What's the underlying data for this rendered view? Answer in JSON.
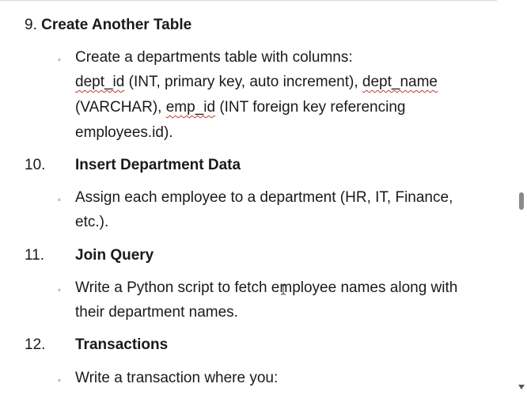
{
  "doc": {
    "item9": {
      "number": "9.",
      "title": "Create Another Table",
      "bullet": "Create a departments table with columns:",
      "line2_a": "dept_id",
      "line2_b": " (INT, primary key, auto increment), ",
      "line2_c": "dept_name",
      "line3_a": "(VARCHAR), ",
      "line3_b": "emp_id",
      "line3_c": " (INT foreign key referencing",
      "line4": "employees.id)."
    },
    "item10": {
      "number": "10.",
      "title": "Insert Department Data",
      "bullet_line1": "Assign each employee to a department (HR, IT, Finance,",
      "bullet_line2": "etc.)."
    },
    "item11": {
      "number": "11.",
      "title": "Join Query",
      "bullet_line1": "Write a Python script to fetch employee names along with",
      "bullet_line2": "their department names."
    },
    "item12": {
      "number": "12.",
      "title": "Transactions",
      "bullet_line1": "Write a transaction where you:"
    },
    "bullet_glyph": "◦"
  }
}
